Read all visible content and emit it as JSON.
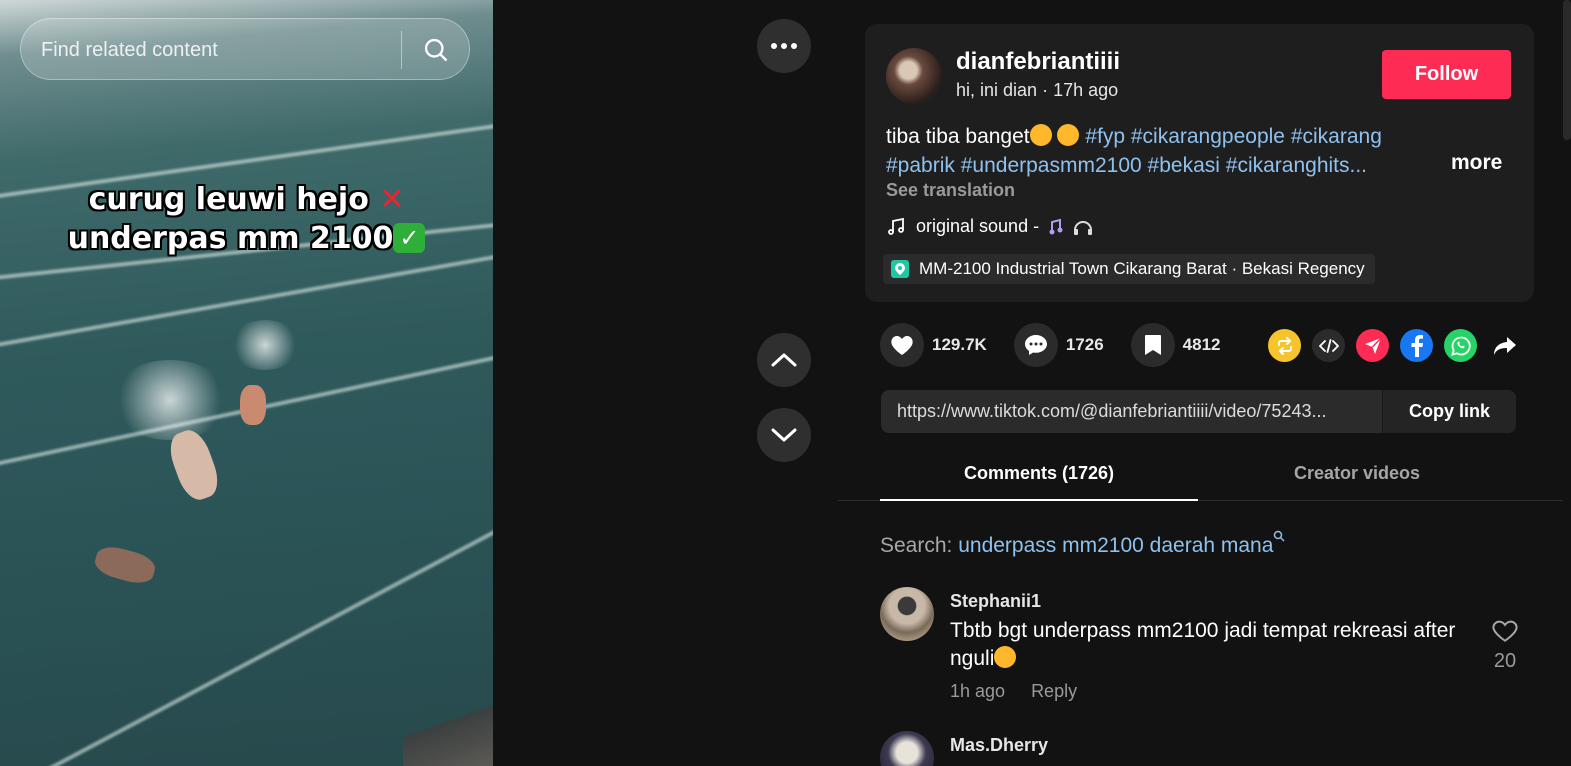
{
  "video": {
    "overlay_line1": "curug leuwi hejo",
    "overlay_line1_mark": "✕",
    "overlay_line2": "underpas mm 2100",
    "overlay_line2_mark": "✓"
  },
  "search": {
    "placeholder": "Find related content",
    "icon": "search-icon"
  },
  "controls": {
    "more_icon": "more-horizontal-icon",
    "up_icon": "chevron-up-icon",
    "down_icon": "chevron-down-icon"
  },
  "post": {
    "username": "dianfebriantiiii",
    "display_name": "hi, ini dian",
    "separator": " · ",
    "time_ago": "17h ago",
    "follow_label": "Follow",
    "description_text": "tiba tiba banget",
    "hashtags_line1": [
      "#fyp",
      "#cikarangpeople",
      "#cikarang"
    ],
    "hashtags_line2": [
      "#pabrik",
      "#underpasmm2100",
      "#bekasi",
      "#cikaranghits..."
    ],
    "more_label": "more",
    "see_translation": "See translation",
    "sound_label": "original sound -",
    "location": "MM-2100 Industrial Town Cikarang Barat · Bekasi Regency"
  },
  "stats": {
    "likes": "129.7K",
    "comments": "1726",
    "saves": "4812"
  },
  "share": {
    "icons": [
      "repost-icon",
      "embed-icon",
      "send-icon",
      "facebook-icon",
      "whatsapp-icon",
      "share-arrow-icon"
    ],
    "colors": {
      "repost": "#f7c52b",
      "embed": "#2b2b2b",
      "send": "#fe2c55",
      "facebook": "#1877f2",
      "whatsapp": "#25d366"
    }
  },
  "link": {
    "url": "https://www.tiktok.com/@dianfebriantiiii/video/75243...",
    "copy_label": "Copy link"
  },
  "tabs": {
    "comments": "Comments (1726)",
    "creator_videos": "Creator videos"
  },
  "comment_search": {
    "prefix": "Search: ",
    "query": "underpass mm2100 daerah mana"
  },
  "comments": [
    {
      "user": "Stephanii1",
      "text": "Tbtb bgt underpass mm2100 jadi tempat rekreasi after nguli",
      "time": "1h ago",
      "reply_label": "Reply",
      "likes": "20"
    },
    {
      "user": "Mas.Dherry"
    }
  ],
  "colors": {
    "accent": "#fe2c55",
    "link": "#8fc1ef",
    "background": "#121212",
    "card": "#1e1e1e"
  }
}
